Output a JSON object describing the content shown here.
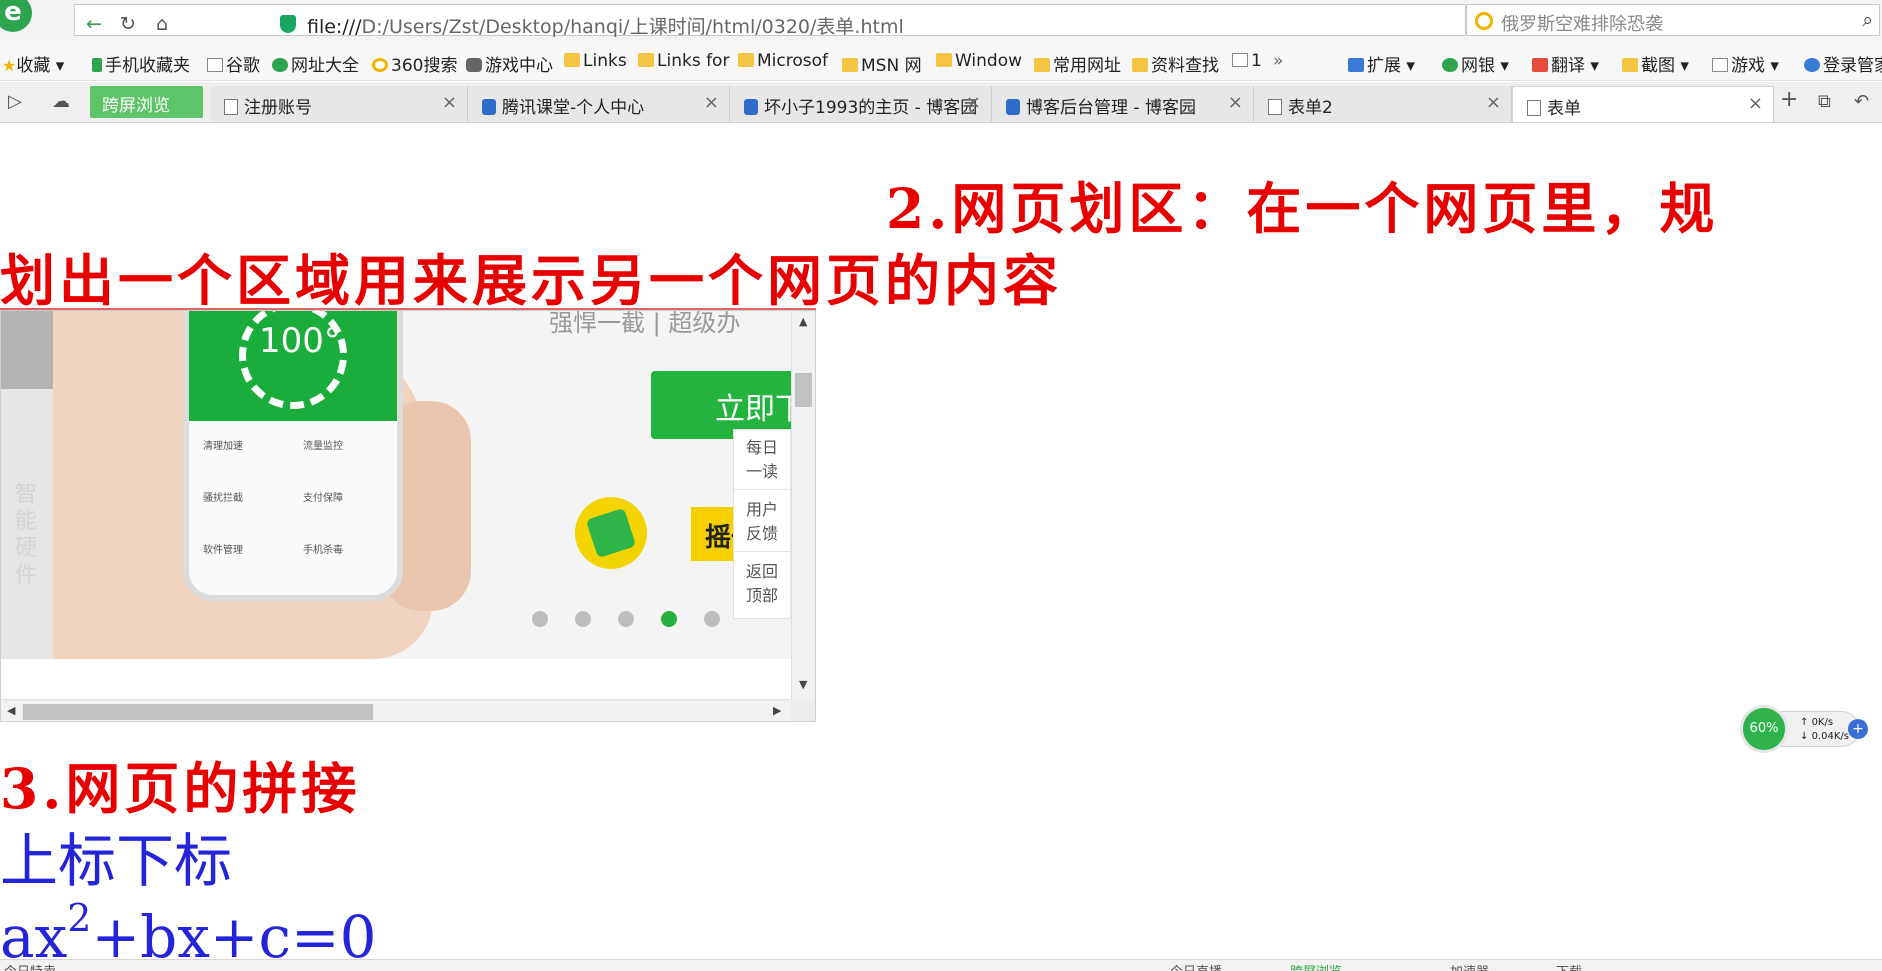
{
  "browser": {
    "address_url_proto": "file:///",
    "address_url_path": "D:/Users/Zst/Desktop/hanqi/上课时间/html/0320/表单.html",
    "search_placeholder": "俄罗斯空难排除恐袭"
  },
  "bookmarks": [
    {
      "label": "收藏",
      "icon": "star-icon"
    },
    {
      "label": "手机收藏夹",
      "icon": "phone-icon"
    },
    {
      "label": "谷歌",
      "icon": "page-icon"
    },
    {
      "label": "网址大全",
      "icon": "globe-icon"
    },
    {
      "label": "360搜索",
      "icon": "search-logo-icon"
    },
    {
      "label": "游戏中心",
      "icon": "gamepad-icon"
    },
    {
      "label": "Links",
      "icon": "folder-icon"
    },
    {
      "label": "Links for",
      "icon": "folder-icon"
    },
    {
      "label": "Microsof",
      "icon": "folder-icon"
    },
    {
      "label": "MSN 网",
      "icon": "folder-icon"
    },
    {
      "label": "Window",
      "icon": "folder-icon"
    },
    {
      "label": "常用网址",
      "icon": "folder-icon"
    },
    {
      "label": "资料查找",
      "icon": "folder-icon"
    },
    {
      "label": "1",
      "icon": "page-icon"
    },
    {
      "label": "扩展",
      "icon": "extension-icon"
    },
    {
      "label": "网银",
      "icon": "bank-icon"
    },
    {
      "label": "翻译",
      "icon": "translate-icon"
    },
    {
      "label": "截图",
      "icon": "screenshot-icon"
    },
    {
      "label": "游戏",
      "icon": "game-icon"
    },
    {
      "label": "登录管家",
      "icon": "login-icon"
    }
  ],
  "tabs": {
    "cross_screen": "跨屏浏览",
    "items": [
      {
        "label": "注册账号"
      },
      {
        "label": "腾讯课堂-个人中心"
      },
      {
        "label": "坏小子1993的主页 - 博客园"
      },
      {
        "label": "博客后台管理 - 博客园"
      },
      {
        "label": "表单2"
      },
      {
        "label": "表单"
      }
    ]
  },
  "page": {
    "heading2_line1": "2.网页划区：在一个网页里，规",
    "heading2_line2": "划出一个区域用来展示另一个网页的内容",
    "heading3": "3.网页的拼接",
    "sub_heading": "上标下标",
    "formula_base": "ax",
    "formula_sup": "2",
    "formula_rest": "+bx+c=0"
  },
  "iframe": {
    "side_text": "智能硬件",
    "promo_top": "强悍一截 | 超级办",
    "cta_label": "立即下",
    "gauge_value": "100°",
    "phone_items": [
      "清理加速",
      "流量监控",
      "骚扰拦截",
      "支付保障",
      "软件管理",
      "手机杀毒"
    ],
    "yellow_tag": "摇一",
    "float_menu": [
      "每日一读",
      "用户反馈",
      "返回顶部"
    ],
    "carousel_active_index": 3,
    "carousel_count": 5
  },
  "net_widget": {
    "percent": "60%",
    "upload": "0K/s",
    "download": "0.04K/s"
  },
  "status_bar": {
    "left": "今日特卖",
    "items": [
      "今日直播",
      "跨屏浏览",
      "加速器",
      "下载"
    ]
  }
}
